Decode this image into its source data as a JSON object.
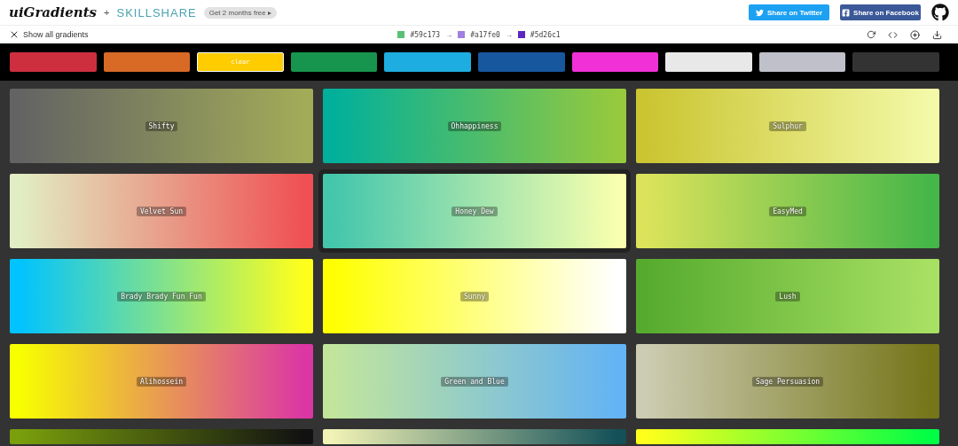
{
  "header": {
    "logo": "uiGradients",
    "plus": "+",
    "partner": "SKILLSHARE",
    "promo": "Get 2 months free",
    "promo_arrow": "▸",
    "share_buttons": [
      {
        "kind": "twitter",
        "label": "Share on Twitter"
      },
      {
        "kind": "facebook",
        "label": "Share on Facebook"
      }
    ]
  },
  "toolbar": {
    "show_all": "Show all gradients",
    "stops": [
      {
        "color": "#59c173",
        "hex": "#59c173"
      },
      {
        "color": "#a17fe0",
        "hex": "#a17fe0"
      },
      {
        "color": "#5d26c1",
        "hex": "#5d26c1"
      }
    ],
    "arrow": "→"
  },
  "filters": [
    {
      "color": "#cd2f3f",
      "selected": false
    },
    {
      "color": "#d86a26",
      "selected": false
    },
    {
      "color": "#ffcc00",
      "selected": true,
      "label": "clear"
    },
    {
      "color": "#17944e",
      "selected": false
    },
    {
      "color": "#1eade0",
      "selected": false
    },
    {
      "color": "#17579d",
      "selected": false
    },
    {
      "color": "#f130d8",
      "selected": false
    },
    {
      "color": "#e8e8e8",
      "selected": false
    },
    {
      "color": "#c0c0ca",
      "selected": false
    },
    {
      "color": "#333333",
      "selected": false
    }
  ],
  "gradients": [
    {
      "name": "Shifty",
      "stops": [
        {
          "color": "#636363"
        },
        {
          "color": "#a2ab58"
        }
      ],
      "selected": false
    },
    {
      "name": "Ohhappiness",
      "stops": [
        {
          "color": "#00b09b"
        },
        {
          "color": "#96c93d"
        }
      ],
      "selected": false
    },
    {
      "name": "Sulphur",
      "stops": [
        {
          "color": "#cac531"
        },
        {
          "color": "#f3f9a7"
        }
      ],
      "selected": false
    },
    {
      "name": "Velvet Sun",
      "stops": [
        {
          "color": "#e1eec3"
        },
        {
          "color": "#f05053"
        }
      ],
      "selected": false
    },
    {
      "name": "Honey Dew",
      "stops": [
        {
          "color": "#43c6ac"
        },
        {
          "color": "#f8ffae"
        }
      ],
      "selected": true
    },
    {
      "name": "EasyMed",
      "stops": [
        {
          "color": "#dce35b"
        },
        {
          "color": "#45b649"
        }
      ],
      "selected": false
    },
    {
      "name": "Brady Brady Fun Fun",
      "stops": [
        {
          "color": "#00c3ff"
        },
        {
          "color": "#ffff1c"
        }
      ],
      "selected": false
    },
    {
      "name": "Sunny",
      "stops": [
        {
          "color": "#ffff00"
        },
        {
          "color": "#ffffff"
        }
      ],
      "selected": false
    },
    {
      "name": "Lush",
      "stops": [
        {
          "color": "#56ab2f"
        },
        {
          "color": "#a8e063"
        }
      ],
      "selected": false
    },
    {
      "name": "Alihossein",
      "stops": [
        {
          "color": "#f7ff00"
        },
        {
          "color": "#db36a4"
        }
      ],
      "selected": false
    },
    {
      "name": "Green and Blue",
      "stops": [
        {
          "color": "#c2e59c"
        },
        {
          "color": "#64b3f4"
        }
      ],
      "selected": false
    },
    {
      "name": "Sage Persuasion",
      "stops": [
        {
          "color": "#ccccb2"
        },
        {
          "color": "#757519"
        }
      ],
      "selected": false
    },
    {
      "stops": [
        {
          "color": "#799f0c"
        },
        {
          "color": "#111111"
        }
      ],
      "selected": false
    },
    {
      "stops": [
        {
          "color": "#f1f2b5"
        },
        {
          "color": "#135058"
        }
      ],
      "selected": false
    },
    {
      "stops": [
        {
          "color": "#ffff1c"
        },
        {
          "color": "#00ff44"
        }
      ],
      "selected": false
    }
  ]
}
